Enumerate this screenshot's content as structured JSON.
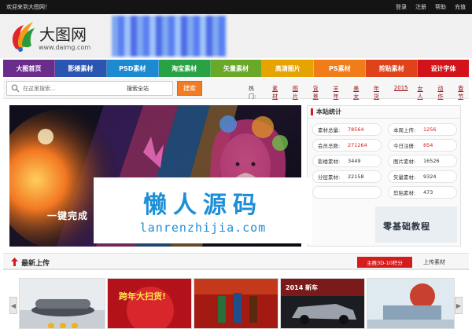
{
  "topbar": {
    "welcome": "欢迎来到大图网！",
    "links": [
      "登录",
      "注册",
      "帮助",
      "充值"
    ]
  },
  "logo": {
    "name": "大图网",
    "url": "www.daimg.com"
  },
  "nav": {
    "tabs": [
      {
        "label": "大图首页",
        "color": "#6a2d8c"
      },
      {
        "label": "影楼素材",
        "color": "#2a56b2"
      },
      {
        "label": "PSD素材",
        "color": "#1b8ad0"
      },
      {
        "label": "淘宝素材",
        "color": "#28a244"
      },
      {
        "label": "矢量素材",
        "color": "#6aa82a"
      },
      {
        "label": "高清图片",
        "color": "#e6a400"
      },
      {
        "label": "PS素材",
        "color": "#f07c1a"
      },
      {
        "label": "剪贴素材",
        "color": "#e0421a"
      },
      {
        "label": "设计字体",
        "color": "#d3131a"
      }
    ]
  },
  "search": {
    "placeholder": "在这里搜索...",
    "scope": "搜索全站",
    "button": "搜索",
    "hot_label": "热门:",
    "hot_keywords": [
      "素材",
      "图片",
      "背景",
      "羊年",
      "美女",
      "年货",
      "2015",
      "女人",
      "动作",
      "春节"
    ]
  },
  "hero": {
    "caption": "一键完成"
  },
  "stats": {
    "title": "本站统计",
    "items": [
      {
        "label": "素材总量:",
        "value": "78564",
        "highlight": true
      },
      {
        "label": "本周上传:",
        "value": "1256",
        "highlight": true
      },
      {
        "label": "会员总数:",
        "value": "271264",
        "highlight": true
      },
      {
        "label": "今日注册:",
        "value": "854",
        "highlight": true
      },
      {
        "label": "影楼素材:",
        "value": "3449",
        "highlight": false
      },
      {
        "label": "图片素材:",
        "value": "16526",
        "highlight": false
      },
      {
        "label": "分层素材:",
        "value": "22158",
        "highlight": false
      },
      {
        "label": "矢量素材:",
        "value": "9324",
        "highlight": false
      },
      {
        "label": "",
        "value": "",
        "highlight": false
      },
      {
        "label": "剪贴素材:",
        "value": "473",
        "highlight": false
      }
    ],
    "promo_text": "零基础教程"
  },
  "watermark": {
    "title": "懒人源码",
    "url": "lanrenzhijia.com"
  },
  "latest": {
    "title": "最新上传",
    "tab_active": "主推3D-10积分",
    "tab_other": "上传素材"
  },
  "thumbs": {
    "t2_text": "跨年大扫货!",
    "t4_text": "2014 新车"
  }
}
